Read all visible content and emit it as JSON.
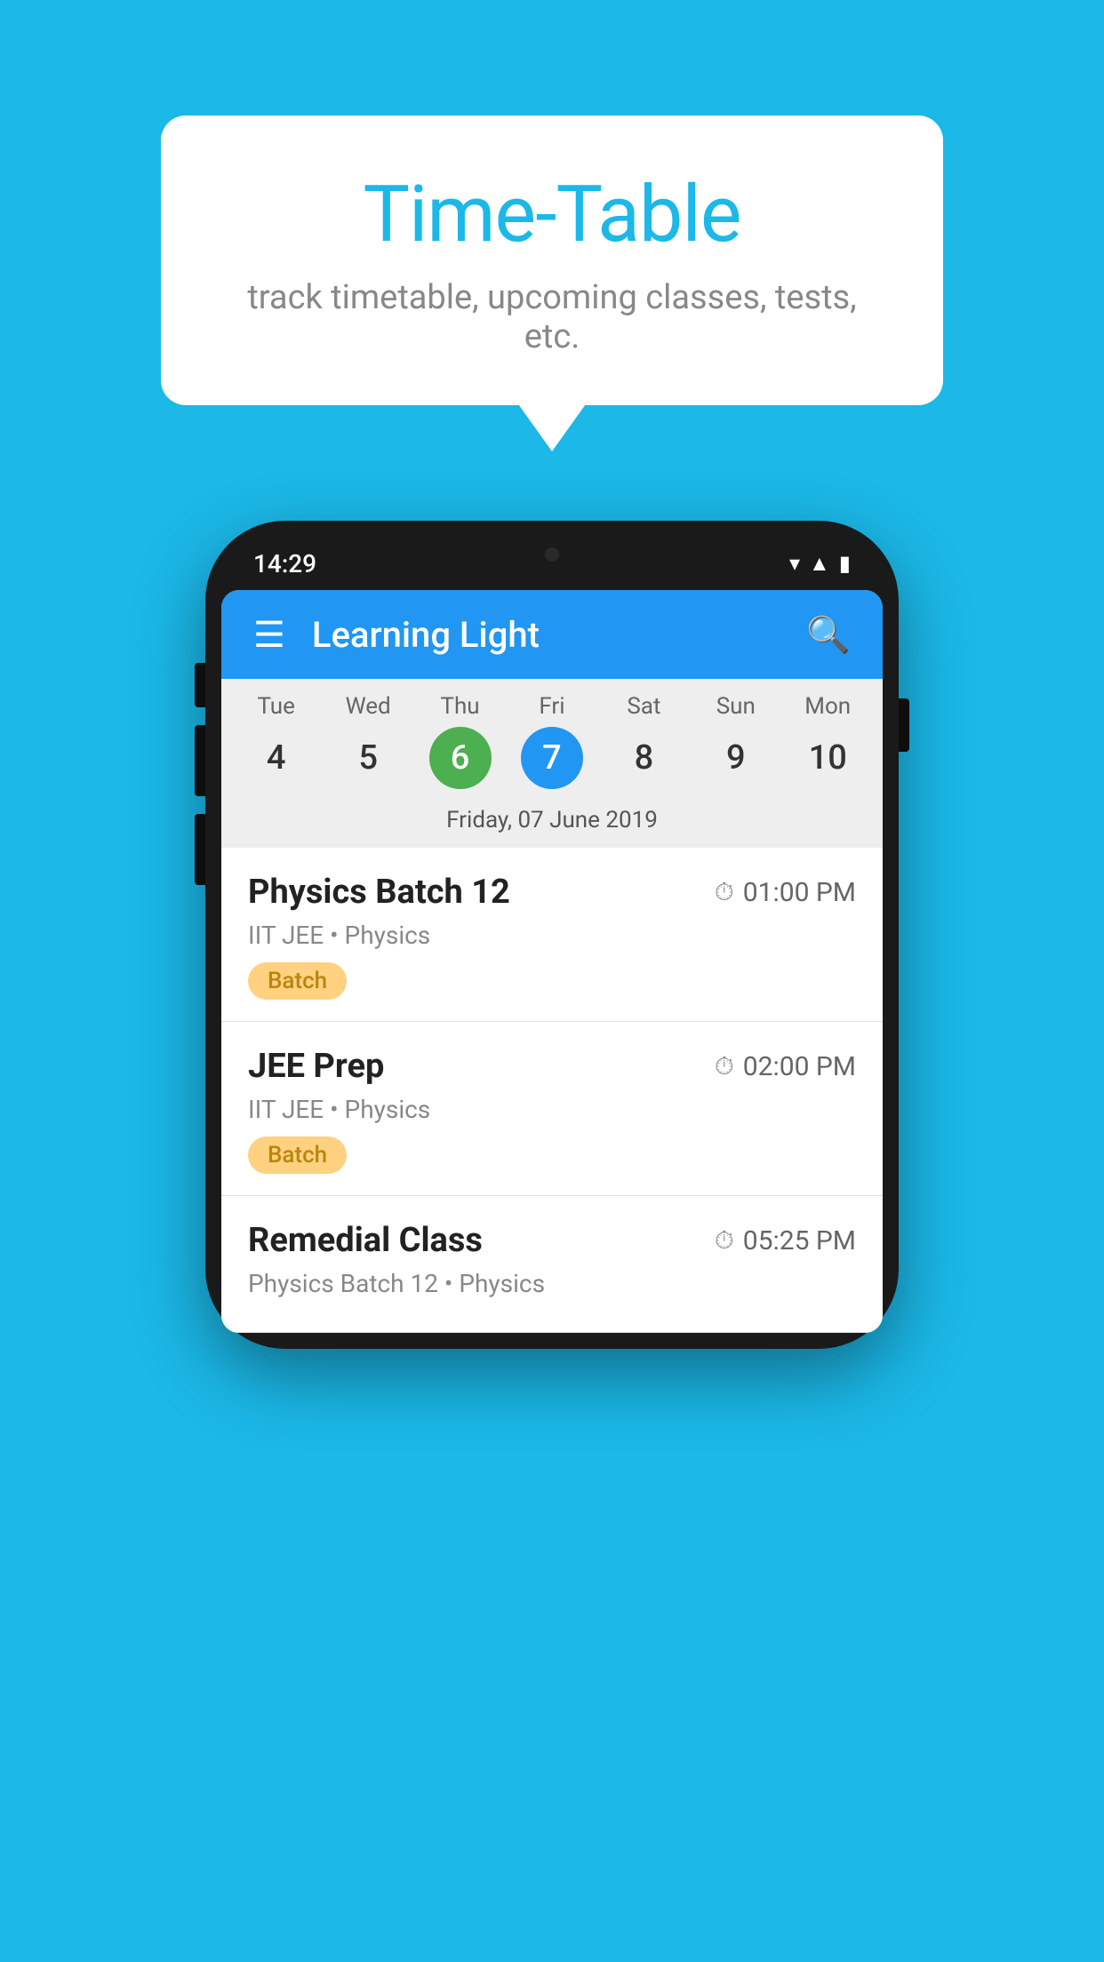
{
  "background_color": "#1bb8e8",
  "speech_bubble": {
    "title": "Time-Table",
    "subtitle": "track timetable, upcoming classes, tests, etc."
  },
  "phone": {
    "status_bar": {
      "time": "14:29"
    },
    "app_bar": {
      "title": "Learning Light"
    },
    "calendar": {
      "days": [
        {
          "name": "Tue",
          "num": "4",
          "state": "normal"
        },
        {
          "name": "Wed",
          "num": "5",
          "state": "normal"
        },
        {
          "name": "Thu",
          "num": "6",
          "state": "today"
        },
        {
          "name": "Fri",
          "num": "7",
          "state": "selected"
        },
        {
          "name": "Sat",
          "num": "8",
          "state": "normal"
        },
        {
          "name": "Sun",
          "num": "9",
          "state": "normal"
        },
        {
          "name": "Mon",
          "num": "10",
          "state": "normal"
        }
      ],
      "selected_date_label": "Friday, 07 June 2019"
    },
    "schedule_items": [
      {
        "title": "Physics Batch 12",
        "time": "01:00 PM",
        "subtitle": "IIT JEE • Physics",
        "badge": "Batch"
      },
      {
        "title": "JEE Prep",
        "time": "02:00 PM",
        "subtitle": "IIT JEE • Physics",
        "badge": "Batch"
      },
      {
        "title": "Remedial Class",
        "time": "05:25 PM",
        "subtitle": "Physics Batch 12 • Physics",
        "badge": null
      }
    ]
  }
}
